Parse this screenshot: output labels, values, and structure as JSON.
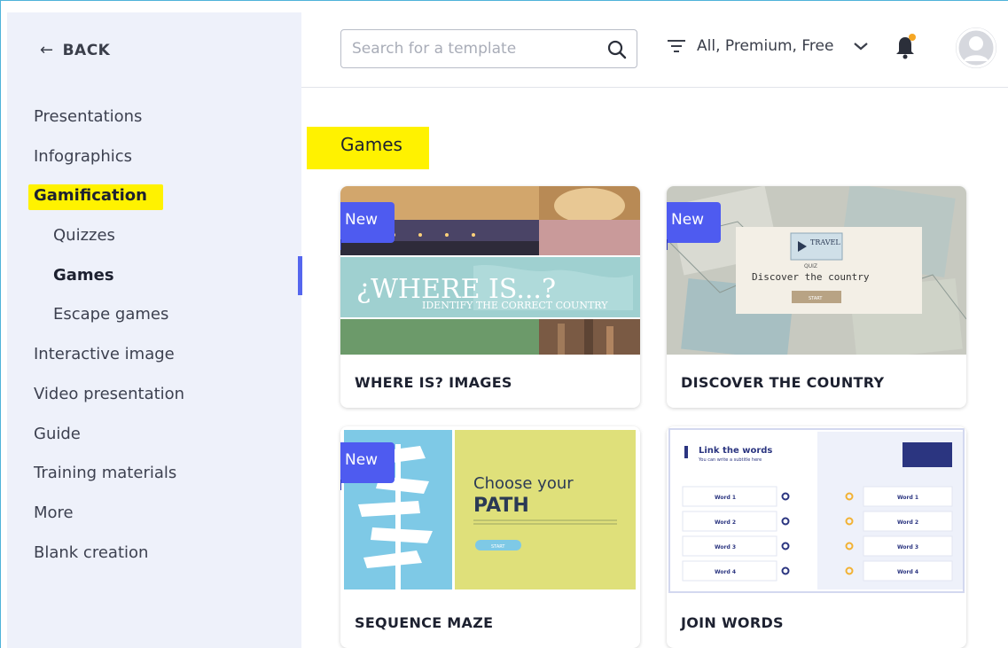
{
  "sidebar": {
    "back_label": "BACK",
    "items": [
      {
        "label": "Presentations"
      },
      {
        "label": "Infographics"
      },
      {
        "label": "Gamification"
      },
      {
        "label": "Quizzes"
      },
      {
        "label": "Games"
      },
      {
        "label": "Escape games"
      },
      {
        "label": "Interactive image"
      },
      {
        "label": "Video presentation"
      },
      {
        "label": "Guide"
      },
      {
        "label": "Training materials"
      },
      {
        "label": "More"
      },
      {
        "label": "Blank creation"
      }
    ]
  },
  "header": {
    "search_placeholder": "Search for a template",
    "filter_label": "All, Premium, Free"
  },
  "main": {
    "section_title": "Games",
    "badge_label": "New",
    "cards": [
      {
        "title": "WHERE IS? IMAGES",
        "thumb_title": "¿WHERE IS...?",
        "thumb_subtitle": "IDENTIFY THE CORRECT COUNTRY"
      },
      {
        "title": "DISCOVER THE COUNTRY",
        "thumb_title": "Discover the country",
        "thumb_kicker": "QUIZ",
        "thumb_stamp": "TRAVEL",
        "thumb_button": "START"
      },
      {
        "title": "SEQUENCE MAZE",
        "thumb_title_line1": "Choose your",
        "thumb_title_line2": "PATH",
        "thumb_body": "Lorem ipsum dolor sit amet, consectetur adipiscing elit. Aliquam quis vulputate sapien, quis vulputate. Cras convallis ornare malesuada.",
        "thumb_button": "START"
      },
      {
        "title": "JOIN WORDS",
        "thumb_title": "Link the words",
        "thumb_subtitle": "You can write a subtitle here",
        "thumb_words_left": [
          "Word 1",
          "Word 2",
          "Word 3",
          "Word 4"
        ],
        "thumb_words_right": [
          "Word 1",
          "Word 2",
          "Word 3",
          "Word 4"
        ]
      }
    ]
  },
  "colors": {
    "accent": "#4e5bf0",
    "highlight": "#fff200",
    "sidebar_bg": "#eef1fa"
  }
}
